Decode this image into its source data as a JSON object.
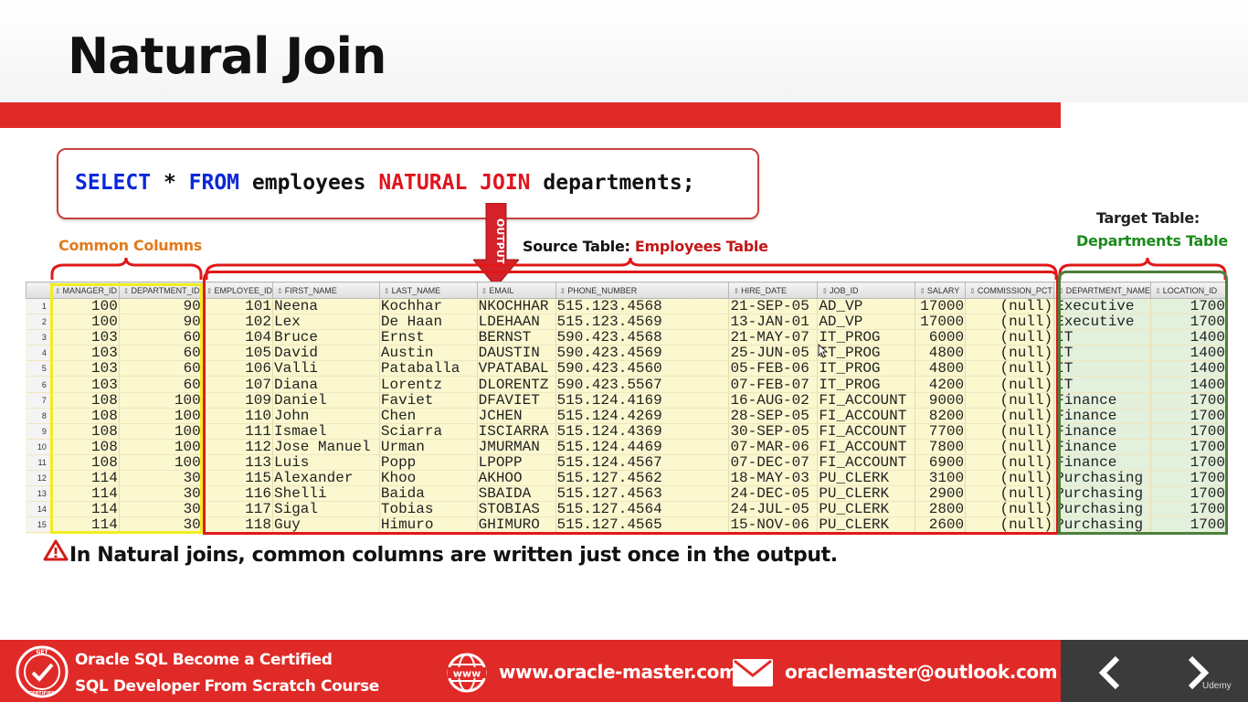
{
  "slide": {
    "title": "Natural Join",
    "sql": {
      "kw_select": "SELECT",
      "star": " * ",
      "kw_from": "FROM",
      "table1": " employees ",
      "kw_natural_join": "NATURAL JOIN",
      "table2": " departments;"
    },
    "output_label": "OUTPUT",
    "labels": {
      "common_columns": "Common Columns",
      "source_prefix": "Source Table: ",
      "source_name": "Employees Table",
      "target_prefix": "Target Table:",
      "target_name": "Departments Table"
    },
    "note": "In Natural joins, common columns are written just once in the output."
  },
  "grid": {
    "columns": [
      "MANAGER_ID",
      "DEPARTMENT_ID",
      "EMPLOYEE_ID",
      "FIRST_NAME",
      "LAST_NAME",
      "EMAIL",
      "PHONE_NUMBER",
      "HIRE_DATE",
      "JOB_ID",
      "SALARY",
      "COMMISSION_PCT",
      "DEPARTMENT_NAME",
      "LOCATION_ID"
    ],
    "rows": [
      [
        "1",
        "100",
        "90",
        "101",
        "Neena",
        "Kochhar",
        "NKOCHHAR",
        "515.123.4568",
        "21-SEP-05",
        "AD_VP",
        "17000",
        "(null)",
        "Executive",
        "1700"
      ],
      [
        "2",
        "100",
        "90",
        "102",
        "Lex",
        "De Haan",
        "LDEHAAN",
        "515.123.4569",
        "13-JAN-01",
        "AD_VP",
        "17000",
        "(null)",
        "Executive",
        "1700"
      ],
      [
        "3",
        "103",
        "60",
        "104",
        "Bruce",
        "Ernst",
        "BERNST",
        "590.423.4568",
        "21-MAY-07",
        "IT_PROG",
        "6000",
        "(null)",
        "IT",
        "1400"
      ],
      [
        "4",
        "103",
        "60",
        "105",
        "David",
        "Austin",
        "DAUSTIN",
        "590.423.4569",
        "25-JUN-05",
        "IT_PROG",
        "4800",
        "(null)",
        "IT",
        "1400"
      ],
      [
        "5",
        "103",
        "60",
        "106",
        "Valli",
        "Pataballa",
        "VPATABAL",
        "590.423.4560",
        "05-FEB-06",
        "IT_PROG",
        "4800",
        "(null)",
        "IT",
        "1400"
      ],
      [
        "6",
        "103",
        "60",
        "107",
        "Diana",
        "Lorentz",
        "DLORENTZ",
        "590.423.5567",
        "07-FEB-07",
        "IT_PROG",
        "4200",
        "(null)",
        "IT",
        "1400"
      ],
      [
        "7",
        "108",
        "100",
        "109",
        "Daniel",
        "Faviet",
        "DFAVIET",
        "515.124.4169",
        "16-AUG-02",
        "FI_ACCOUNT",
        "9000",
        "(null)",
        "Finance",
        "1700"
      ],
      [
        "8",
        "108",
        "100",
        "110",
        "John",
        "Chen",
        "JCHEN",
        "515.124.4269",
        "28-SEP-05",
        "FI_ACCOUNT",
        "8200",
        "(null)",
        "Finance",
        "1700"
      ],
      [
        "9",
        "108",
        "100",
        "111",
        "Ismael",
        "Sciarra",
        "ISCIARRA",
        "515.124.4369",
        "30-SEP-05",
        "FI_ACCOUNT",
        "7700",
        "(null)",
        "Finance",
        "1700"
      ],
      [
        "10",
        "108",
        "100",
        "112",
        "Jose Manuel",
        "Urman",
        "JMURMAN",
        "515.124.4469",
        "07-MAR-06",
        "FI_ACCOUNT",
        "7800",
        "(null)",
        "Finance",
        "1700"
      ],
      [
        "11",
        "108",
        "100",
        "113",
        "Luis",
        "Popp",
        "LPOPP",
        "515.124.4567",
        "07-DEC-07",
        "FI_ACCOUNT",
        "6900",
        "(null)",
        "Finance",
        "1700"
      ],
      [
        "12",
        "114",
        "30",
        "115",
        "Alexander",
        "Khoo",
        "AKHOO",
        "515.127.4562",
        "18-MAY-03",
        "PU_CLERK",
        "3100",
        "(null)",
        "Purchasing",
        "1700"
      ],
      [
        "13",
        "114",
        "30",
        "116",
        "Shelli",
        "Baida",
        "SBAIDA",
        "515.127.4563",
        "24-DEC-05",
        "PU_CLERK",
        "2900",
        "(null)",
        "Purchasing",
        "1700"
      ],
      [
        "14",
        "114",
        "30",
        "117",
        "Sigal",
        "Tobias",
        "STOBIAS",
        "515.127.4564",
        "24-JUL-05",
        "PU_CLERK",
        "2800",
        "(null)",
        "Purchasing",
        "1700"
      ],
      [
        "15",
        "114",
        "30",
        "118",
        "Guy",
        "Himuro",
        "GHIMURO",
        "515.127.4565",
        "15-NOV-06",
        "PU_CLERK",
        "2600",
        "(null)",
        "Purchasing",
        "1700"
      ]
    ]
  },
  "footer": {
    "course_line1": "Oracle SQL Become a Certified",
    "course_line2": "SQL  Developer  From Scratch Course",
    "website": "www.oracle-master.com",
    "email": "oraclemaster@outlook.com",
    "brand": "Udemy",
    "badge_top": "GET",
    "badge_bottom": "CERTIFIED",
    "web_icon_text": "www"
  },
  "colors": {
    "accent_red": "#e02a27",
    "keyword_blue": "#0b27d8",
    "keyword_red": "#e0141d",
    "common_orange": "#e27a1c",
    "target_green": "#1d8a1d",
    "grid_yellow": "#fbf7cf",
    "dept_green": "#e3f0dc"
  },
  "icons": [
    "warning-icon",
    "certified-badge-icon",
    "www-globe-icon",
    "mail-icon",
    "chevron-left-icon",
    "chevron-right-icon",
    "cursor-icon"
  ]
}
